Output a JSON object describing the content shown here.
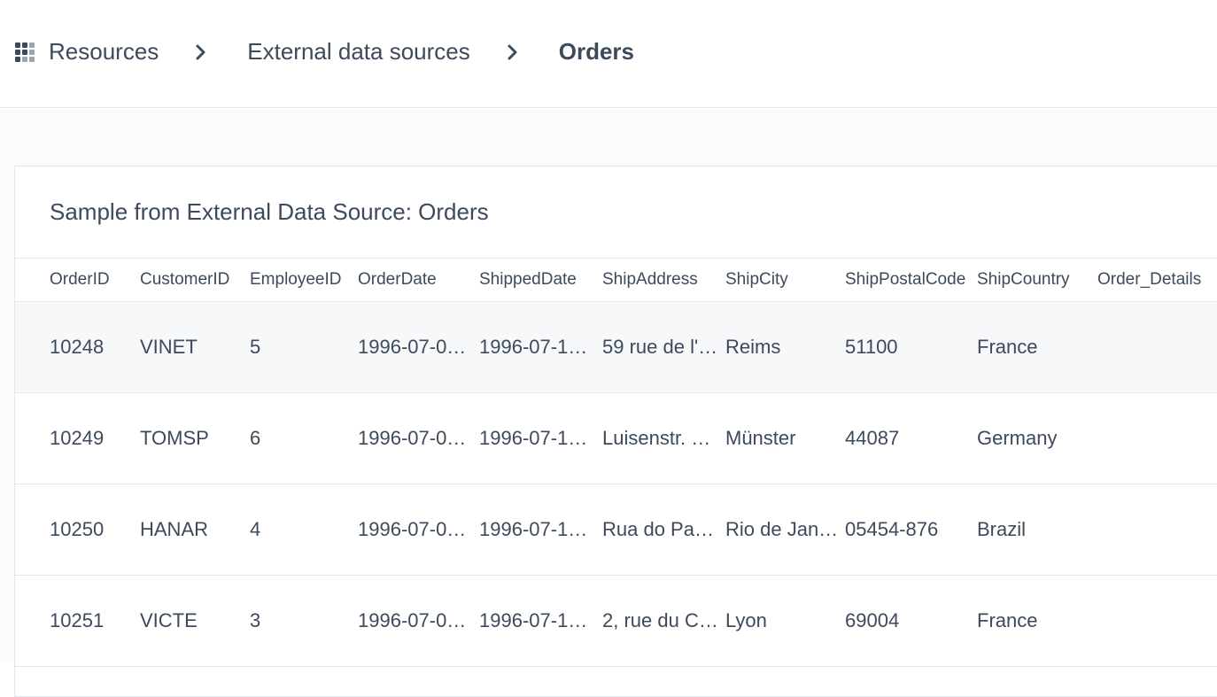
{
  "breadcrumb": {
    "items": [
      "Resources",
      "External data sources",
      "Orders"
    ]
  },
  "card": {
    "title": "Sample from External Data Source: Orders"
  },
  "table": {
    "columns": [
      "OrderID",
      "CustomerID",
      "EmployeeID",
      "OrderDate",
      "ShippedDate",
      "ShipAddress",
      "ShipCity",
      "ShipPostalCode",
      "ShipCountry",
      "Order_Details"
    ],
    "rows": [
      [
        "10248",
        "VINET",
        "5",
        "1996-07-0…",
        "1996-07-1…",
        "59 rue de l'…",
        "Reims",
        "51100",
        "France",
        ""
      ],
      [
        "10249",
        "TOMSP",
        "6",
        "1996-07-0…",
        "1996-07-1…",
        "Luisenstr. …",
        "Münster",
        "44087",
        "Germany",
        ""
      ],
      [
        "10250",
        "HANAR",
        "4",
        "1996-07-0…",
        "1996-07-1…",
        "Rua do Pa…",
        "Rio de Jan…",
        "05454-876",
        "Brazil",
        ""
      ],
      [
        "10251",
        "VICTE",
        "3",
        "1996-07-0…",
        "1996-07-1…",
        "2, rue du C…",
        "Lyon",
        "69004",
        "France",
        ""
      ]
    ]
  },
  "icons": {
    "resources": "grid-icon",
    "separator": "chevron-right-icon"
  },
  "colors": {
    "text": "#3c4a5c",
    "border": "#e3e6ea",
    "page_bg": "#fafbfc",
    "row_hover": "#f6f8fa"
  }
}
